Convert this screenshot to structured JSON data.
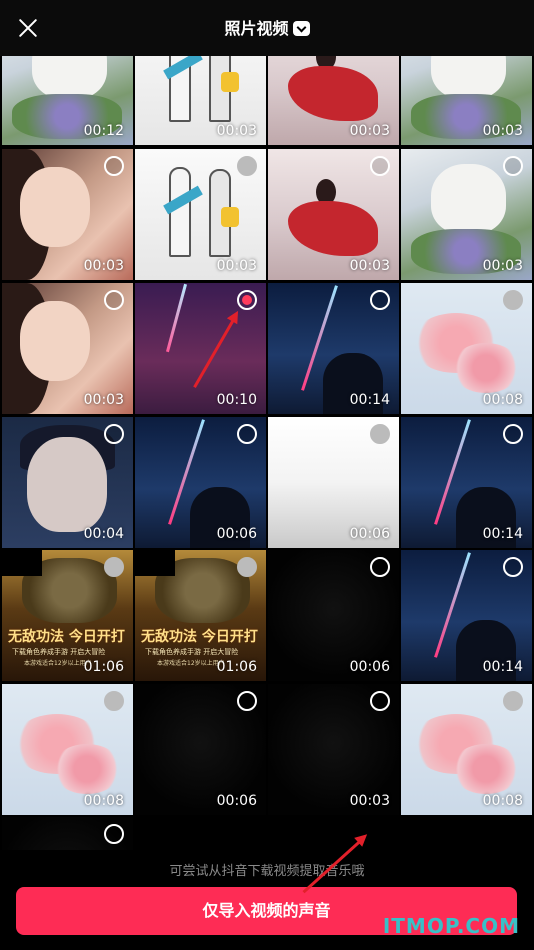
{
  "header": {
    "title": "照片视频",
    "close_icon": "close-icon",
    "dropdown_icon": "chevron-down-icon"
  },
  "grid": {
    "tiles": [
      {
        "theme": "cat",
        "duration": "00:12",
        "select": "none"
      },
      {
        "theme": "sketch",
        "duration": "00:03",
        "select": "none"
      },
      {
        "theme": "red",
        "duration": "00:03",
        "select": "none"
      },
      {
        "theme": "cat",
        "duration": "00:03",
        "select": "none"
      },
      {
        "theme": "girl",
        "duration": "00:03",
        "select": "empty"
      },
      {
        "theme": "sketch",
        "duration": "00:03",
        "select": "gray"
      },
      {
        "theme": "red",
        "duration": "00:03",
        "select": "empty"
      },
      {
        "theme": "cat",
        "duration": "00:03",
        "select": "empty"
      },
      {
        "theme": "girl",
        "duration": "00:03",
        "select": "empty"
      },
      {
        "theme": "purple",
        "duration": "00:10",
        "select": "on"
      },
      {
        "theme": "night",
        "duration": "00:14",
        "select": "empty"
      },
      {
        "theme": "blossom",
        "duration": "00:08",
        "select": "gray"
      },
      {
        "theme": "anime",
        "duration": "00:04",
        "select": "empty"
      },
      {
        "theme": "night",
        "duration": "00:06",
        "select": "empty"
      },
      {
        "theme": "white",
        "duration": "00:06",
        "select": "gray"
      },
      {
        "theme": "night",
        "duration": "00:14",
        "select": "empty"
      },
      {
        "theme": "game",
        "duration": "01:06",
        "select": "gray"
      },
      {
        "theme": "game",
        "duration": "01:06",
        "select": "gray"
      },
      {
        "theme": "black",
        "duration": "00:06",
        "select": "empty"
      },
      {
        "theme": "night",
        "duration": "00:14",
        "select": "empty"
      },
      {
        "theme": "blossom",
        "duration": "00:08",
        "select": "gray"
      },
      {
        "theme": "black",
        "duration": "00:06",
        "select": "empty"
      },
      {
        "theme": "black",
        "duration": "00:03",
        "select": "empty"
      },
      {
        "theme": "blossom",
        "duration": "00:08",
        "select": "gray"
      },
      {
        "theme": "black",
        "duration": "",
        "select": "empty"
      }
    ],
    "game_banner": "无敌功法 今日开打",
    "game_sub": "下载角色养成手游 开启大冒险",
    "game_sub2": "本游戏适合12岁以上用户"
  },
  "hint": "可尝试从抖音下载视频提取音乐哦",
  "import_button": "仅导入视频的声音",
  "watermark": "ITMOP.COM",
  "colors": {
    "accent": "#fe2c55",
    "selected_dot": "#ff3b5c",
    "annotation_arrow": "#e2202a",
    "watermark": "#39c1c7"
  }
}
